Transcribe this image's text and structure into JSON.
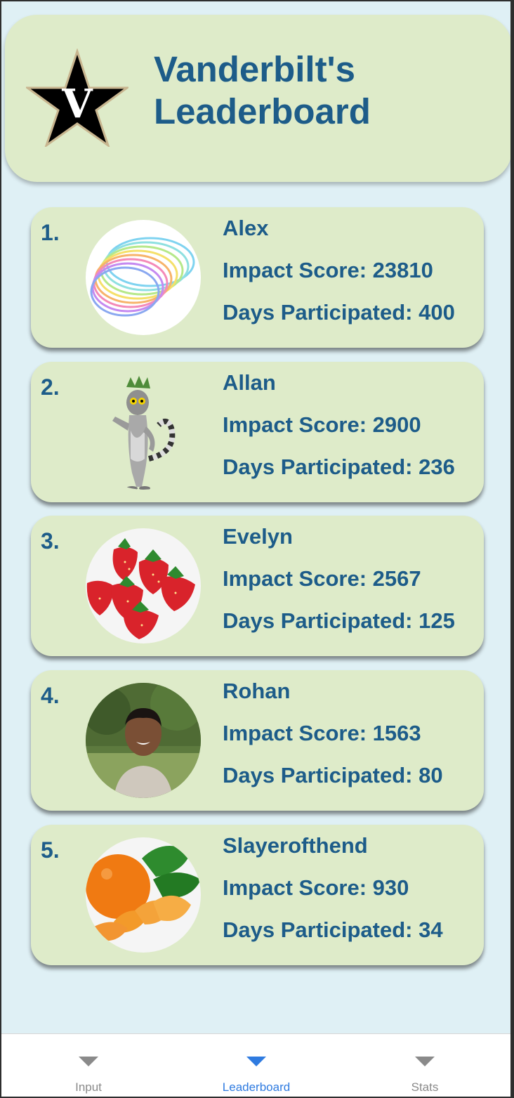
{
  "header": {
    "title_line1": "Vanderbilt's",
    "title_line2": "Leaderboard",
    "logo_letter": "V"
  },
  "entries": [
    {
      "rank": "1.",
      "name": "Alex",
      "impact": "Impact Score: 23810",
      "days": "Days Participated: 400",
      "avatar": "slinky-image"
    },
    {
      "rank": "2.",
      "name": "Allan",
      "impact": "Impact Score: 2900",
      "days": "Days Participated: 236",
      "avatar": "lemur-image"
    },
    {
      "rank": "3.",
      "name": "Evelyn",
      "impact": "Impact Score: 2567",
      "days": "Days Participated: 125",
      "avatar": "strawberries-image"
    },
    {
      "rank": "4.",
      "name": "Rohan",
      "impact": "Impact Score: 1563",
      "days": "Days Participated: 80",
      "avatar": "person-photo"
    },
    {
      "rank": "5.",
      "name": "Slayerofthend",
      "impact": "Impact Score: 930",
      "days": "Days Participated: 34",
      "avatar": "oranges-image"
    }
  ],
  "nav": {
    "items": [
      {
        "label": "Input",
        "icon": "triangle-down-icon",
        "active": false
      },
      {
        "label": "Leaderboard",
        "icon": "triangle-down-icon",
        "active": true
      },
      {
        "label": "Stats",
        "icon": "triangle-down-icon",
        "active": false
      }
    ]
  },
  "colors": {
    "accent": "#1d5c89",
    "card_bg": "#deebc9",
    "page_bg": "#dff0f5",
    "nav_active": "#2f7be0",
    "nav_inactive": "#8a8a8a"
  }
}
